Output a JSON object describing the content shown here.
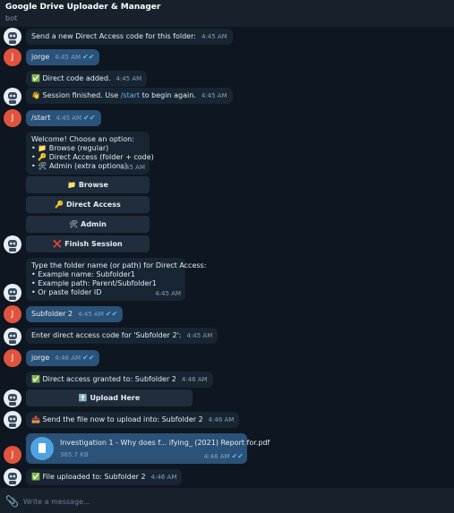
{
  "header": {
    "title": "Google Drive Uploader & Manager",
    "subtitle": "bot"
  },
  "user_initial": "J",
  "messages": [
    {
      "text": "Send a new Direct Access code for this folder:",
      "time": "4:45 AM"
    },
    {
      "text": "jorge",
      "time": "4:45 AM"
    },
    {
      "emoji": "✅",
      "text": "Direct code added.",
      "time": "4:45 AM"
    },
    {
      "emoji": "👋",
      "pre": "Session finished. Use ",
      "link": "/start",
      "post": " to begin again.",
      "time": "4:45 AM"
    },
    {
      "text": "/start",
      "time": "4:45 AM"
    },
    {
      "lines": [
        "Welcome! Choose an option:",
        "• 📁 Browse (regular)",
        "• 🔑 Direct Access (folder + code)",
        "• 🛠 Admin (extra options)"
      ],
      "time": "4:45 AM"
    },
    {
      "lines": [
        "Type the folder name (or path) for Direct Access:",
        "• Example name: Subfolder1",
        "• Example path: Parent/Subfolder1",
        "• Or paste folder ID"
      ],
      "time": "4:45 AM"
    },
    {
      "text": "Subfolder 2",
      "time": "4:45 AM"
    },
    {
      "text": "Enter direct access code for 'Subfolder 2':",
      "time": "4:45 AM"
    },
    {
      "text": "jorge",
      "time": "4:46 AM"
    },
    {
      "emoji": "✅",
      "text": "Direct access granted to: Subfolder 2",
      "time": "4:46 AM"
    },
    {
      "emoji": "📤",
      "text": "Send the file now to upload into: Subfolder 2",
      "time": "4:46 AM"
    },
    {
      "file_name": "Investigation 1 - Why does f... ifying_ (2021) Report for.pdf",
      "file_size": "365.7 KB",
      "time": "4:46 AM"
    },
    {
      "emoji": "✅",
      "text": "File uploaded to: Subfolder 2",
      "time": "4:46 AM"
    }
  ],
  "menu_buttons": [
    {
      "emoji": "📁",
      "label": "Browse"
    },
    {
      "emoji": "🔑",
      "label": "Direct Access"
    },
    {
      "emoji": "🛠",
      "label": "Admin"
    },
    {
      "emoji": "❌",
      "label": "Finish Session"
    }
  ],
  "upload_button": {
    "emoji": "⬆️",
    "label": "Upload Here"
  },
  "composer": {
    "placeholder": "Write a message..."
  }
}
